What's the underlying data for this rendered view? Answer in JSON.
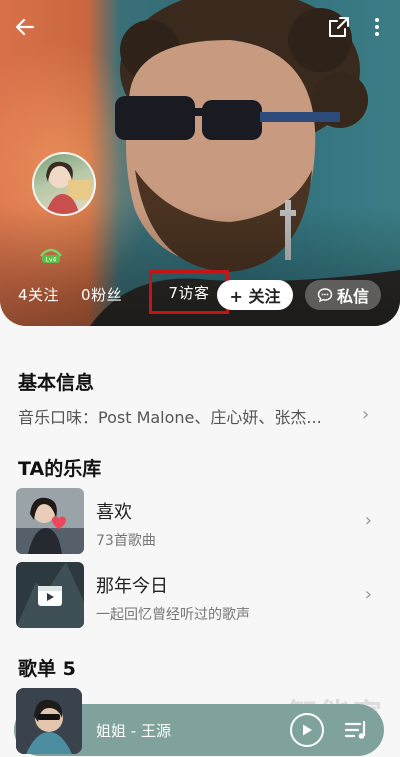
{
  "header": {
    "back_icon": "arrow-left-icon",
    "share_icon": "share-out-icon",
    "more_icon": "more-vertical-icon",
    "level_badge": "Lv4"
  },
  "stats": {
    "follows": "4关注",
    "fans": "0粉丝",
    "visitors": "7访客"
  },
  "actions": {
    "follow_label": "+ 关注",
    "message_label": "私信"
  },
  "basic_info": {
    "title": "基本信息",
    "music_taste": "音乐口味：Post Malone、庄心妍、张杰..."
  },
  "library": {
    "title": "TA的乐库",
    "items": [
      {
        "title": "喜欢",
        "subtitle": "73首歌曲"
      },
      {
        "title": "那年今日",
        "subtitle": "一起回忆曾经听过的歌声"
      }
    ]
  },
  "playlists": {
    "title": "歌单 5"
  },
  "player": {
    "now_playing": "姐姐 - 王源"
  },
  "watermark": "智能家",
  "colors": {
    "highlight_border": "#c41414",
    "player_bg": "#7fa39c",
    "heart": "#f0465a"
  }
}
